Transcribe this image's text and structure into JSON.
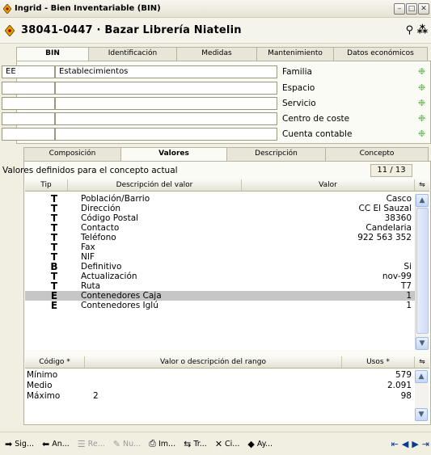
{
  "window": {
    "title": "Ingrid - Bien Inventariable (BIN)"
  },
  "header": {
    "title": "38041-0447 · Bazar Librería Niatelin",
    "tools": "⚲ ⁂"
  },
  "top_tabs": [
    {
      "label": "BIN",
      "active": true
    },
    {
      "label": "Identificación"
    },
    {
      "label": "Medidas"
    },
    {
      "label": "Mantenimiento"
    },
    {
      "label": "Datos económicos"
    }
  ],
  "classification": [
    {
      "code": "EE",
      "desc": "Establecimientos",
      "label": "Familia"
    },
    {
      "code": "",
      "desc": "",
      "label": "Espacio"
    },
    {
      "code": "",
      "desc": "",
      "label": "Servicio"
    },
    {
      "code": "",
      "desc": "",
      "label": "Centro de coste"
    },
    {
      "code": "",
      "desc": "",
      "label": "Cuenta contable"
    }
  ],
  "mid_tabs": [
    {
      "label": "Composición"
    },
    {
      "label": "Valores",
      "active": true
    },
    {
      "label": "Descripción"
    },
    {
      "label": "Concepto"
    }
  ],
  "values_panel": {
    "label": "Valores definidos para el concepto actual",
    "count": "11 / 13",
    "columns": [
      "Tip",
      "Descripción del valor",
      "Valor"
    ],
    "rows": [
      {
        "tip": "T",
        "desc": "Población/Barrio",
        "val": "Casco"
      },
      {
        "tip": "T",
        "desc": "Dirección",
        "val": "CC El Sauzal"
      },
      {
        "tip": "T",
        "desc": "Código Postal",
        "val": "38360"
      },
      {
        "tip": "T",
        "desc": "Contacto",
        "val": "Candelaria"
      },
      {
        "tip": "T",
        "desc": "Teléfono",
        "val": "922 563 352"
      },
      {
        "tip": "T",
        "desc": "Fax",
        "val": ""
      },
      {
        "tip": "T",
        "desc": "NIF",
        "val": ""
      },
      {
        "tip": "B",
        "desc": "Definitivo",
        "val": "Si"
      },
      {
        "tip": "T",
        "desc": "Actualización",
        "val": "nov-99"
      },
      {
        "tip": "T",
        "desc": "Ruta",
        "val": "T7"
      },
      {
        "tip": "E",
        "desc": "Contenedores Caja",
        "val": "1",
        "selected": true
      },
      {
        "tip": "E",
        "desc": "Contenedores Iglú",
        "val": "1"
      }
    ]
  },
  "range_panel": {
    "columns": [
      "Código *",
      "Valor o descripción del rango",
      "Usos *"
    ],
    "rows": [
      {
        "code": "Mínimo",
        "desc": "",
        "uses": "579"
      },
      {
        "code": "Medio",
        "desc": "",
        "uses": "2.091"
      },
      {
        "code": "Máximo",
        "desc": "2",
        "uses": "98"
      }
    ]
  },
  "bottom_buttons": [
    {
      "label": "Sig...",
      "icon": "➡",
      "disabled": false
    },
    {
      "label": "An...",
      "icon": "⬅",
      "disabled": false
    },
    {
      "label": "Re...",
      "icon": "☰",
      "disabled": true
    },
    {
      "label": "Nu...",
      "icon": "✎",
      "disabled": true
    },
    {
      "label": "Im...",
      "icon": "⎙",
      "disabled": false
    },
    {
      "label": "Tr...",
      "icon": "⇆",
      "disabled": false
    },
    {
      "label": "Ci...",
      "icon": "✕",
      "disabled": false
    },
    {
      "label": "Ay...",
      "icon": "◆",
      "disabled": false
    }
  ]
}
